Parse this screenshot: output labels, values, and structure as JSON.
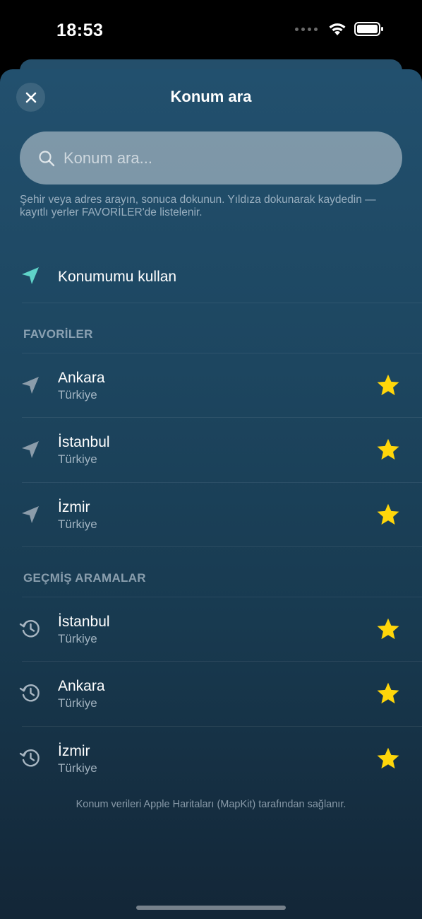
{
  "status": {
    "time": "18:53"
  },
  "sheet": {
    "title": "Konum ara",
    "search_placeholder": "Konum ara...",
    "hint": "Şehir veya adres arayın, sonuca dokunun. Yıldıza dokunarak kaydedin — kayıtlı yerler FAVORİLER'de listelenir.",
    "use_location_label": "Konumumu kullan",
    "favorites_header": "FAVORİLER",
    "favorites": [
      {
        "title": "Ankara",
        "subtitle": "Türkiye"
      },
      {
        "title": "İstanbul",
        "subtitle": "Türkiye"
      },
      {
        "title": "İzmir",
        "subtitle": "Türkiye"
      }
    ],
    "history_header": "GEÇMİŞ ARAMALAR",
    "history": [
      {
        "title": "İstanbul",
        "subtitle": "Türkiye"
      },
      {
        "title": "Ankara",
        "subtitle": "Türkiye"
      },
      {
        "title": "İzmir",
        "subtitle": "Türkiye"
      }
    ],
    "footer": "Konum verileri Apple Haritaları (MapKit) tarafından sağlanır."
  },
  "colors": {
    "accent_location": "#5fd3c8",
    "star": "#ffd60a",
    "sheet_top": "#22506e",
    "sheet_bottom": "#132637"
  }
}
